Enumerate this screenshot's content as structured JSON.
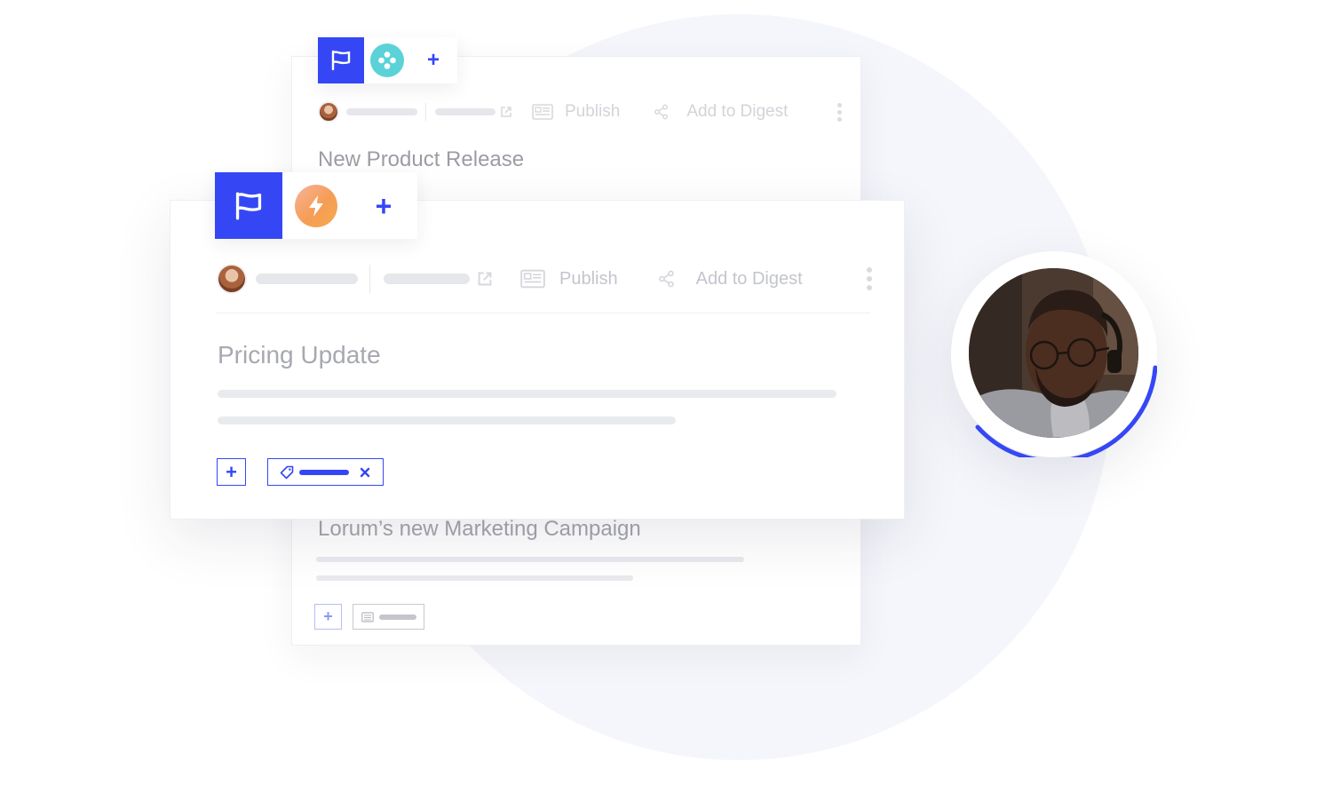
{
  "colors": {
    "accent": "#3547f5",
    "teal_app": "#5ad2d8",
    "orange_app": "#f59d55",
    "placeholder": "#e6e7eb",
    "muted_text": "#a9abb2"
  },
  "back_card": {
    "tabs": [
      {
        "icon": "flag-icon"
      },
      {
        "icon": "teal-app-icon"
      },
      {
        "icon": "plus-icon"
      }
    ],
    "toolbar": {
      "publish_label": "Publish",
      "digest_label": "Add to Digest"
    },
    "title_1": "New Product Release",
    "title_2": "Lorum’s new Marketing Campaign"
  },
  "front_card": {
    "tabs": [
      {
        "icon": "flag-icon"
      },
      {
        "icon": "lightning-app-icon"
      },
      {
        "icon": "plus-icon"
      }
    ],
    "toolbar": {
      "publish_label": "Publish",
      "digest_label": "Add to Digest"
    },
    "title": "Pricing Update"
  }
}
